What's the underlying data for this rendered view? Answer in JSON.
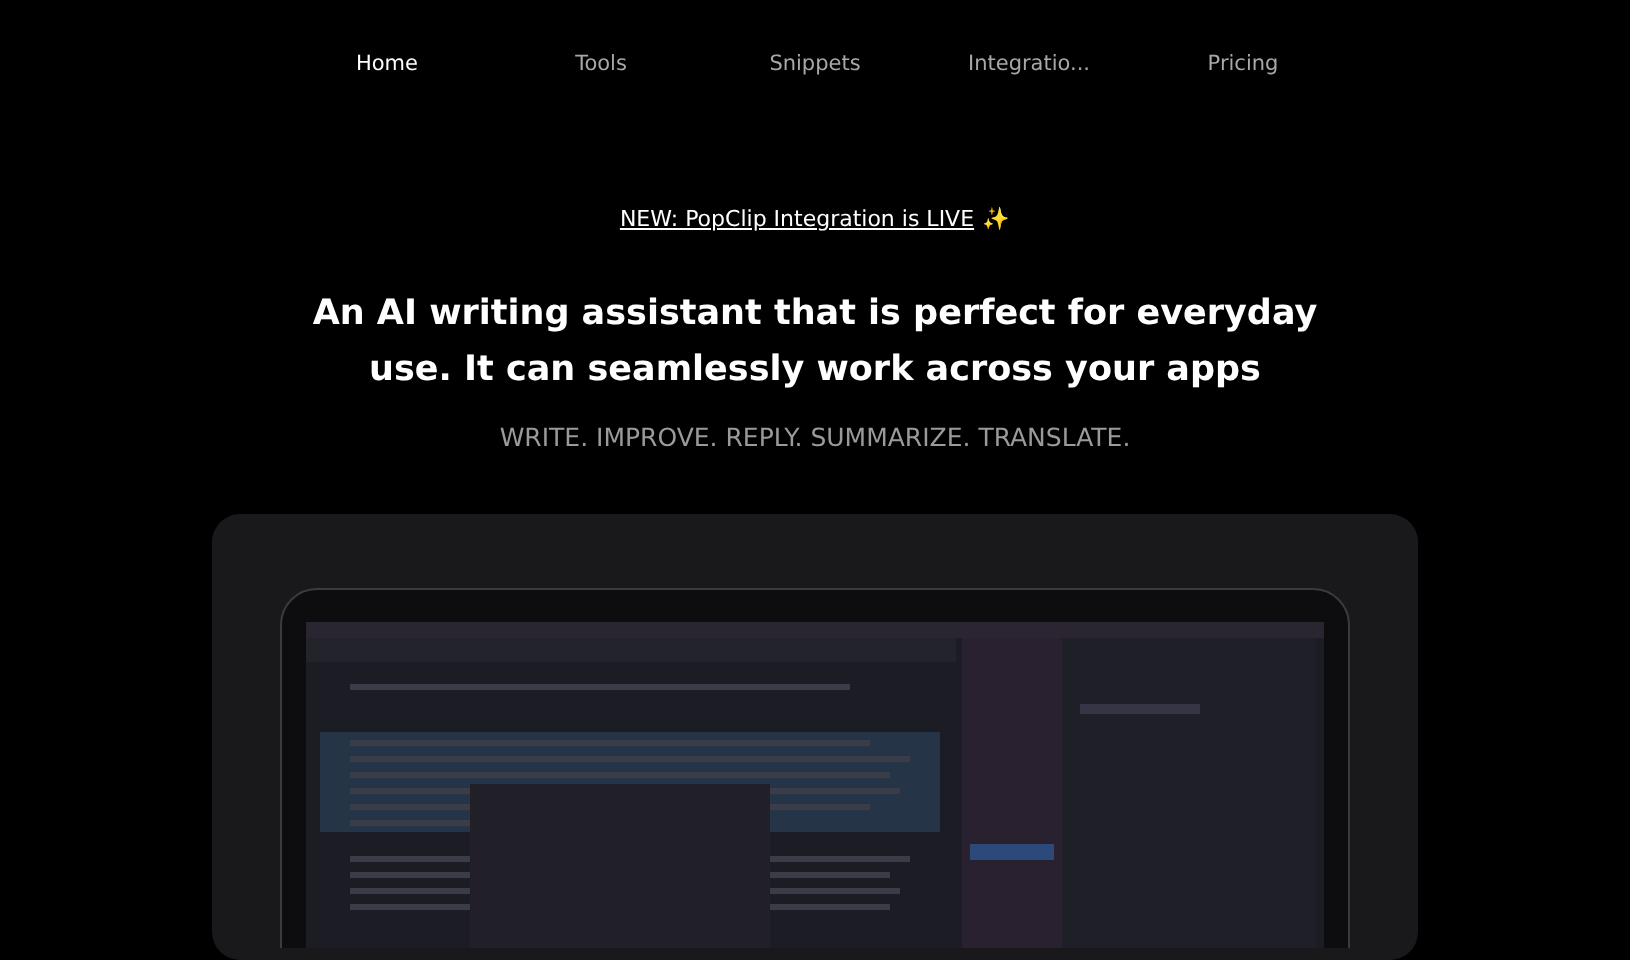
{
  "nav": {
    "items": [
      {
        "label": "Home",
        "selected": true
      },
      {
        "label": "Tools",
        "selected": false
      },
      {
        "label": "Snippets",
        "selected": false
      },
      {
        "label": "Integratio...",
        "selected": false
      },
      {
        "label": "Pricing",
        "selected": false
      }
    ]
  },
  "announcement": {
    "text": "NEW: PopClip Integration is LIVE",
    "icon": "✨"
  },
  "headline": "An AI writing assistant that is perfect for everyday use. It can seamlessly work across your apps",
  "tagline": "WRITE. IMPROVE. REPLY. SUMMARIZE. TRANSLATE."
}
